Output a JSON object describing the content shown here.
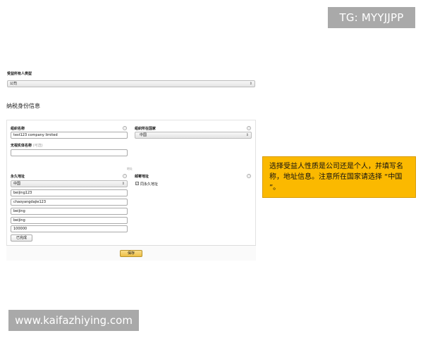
{
  "watermarks": {
    "top": "TG: MYYJJPP",
    "bottom": "www.kaifazhiying.com"
  },
  "beneficiary": {
    "label": "受益所有人类型",
    "value": "公司"
  },
  "tax_section": {
    "title": "纳税身份信息"
  },
  "org_name": {
    "label": "组织名称",
    "value": "test123 company limited"
  },
  "org_country": {
    "label": "组织所在国家",
    "value": "中国"
  },
  "disregarded": {
    "label": "无视实体名称",
    "hint": "(可选)",
    "value": ""
  },
  "address_divider": "地址",
  "permanent_address": {
    "label": "永久地址",
    "country": "中国",
    "line1": "beijing123",
    "line2": "chaoyangdajie123",
    "city": "beijing",
    "province": "beijing",
    "postcode": "100000"
  },
  "mailing_address": {
    "label": "邮寄地址",
    "same_as_permanent": "同永久地址",
    "checked": true
  },
  "buttons": {
    "done": "已完成",
    "save": "保存"
  },
  "callout": {
    "text": "选择受益人性质是公司还是个人，并填写名称，地址信息。注意所在国家请选择 “中国 ”。"
  },
  "icons": {
    "info": "info-icon",
    "dropdown": "chevron-down-icon",
    "checkbox": "checkmark-icon"
  },
  "colors": {
    "save_button": "#eebf45",
    "callout_bg": "#fbb900",
    "watermark_bg": "#a9a9a9"
  }
}
